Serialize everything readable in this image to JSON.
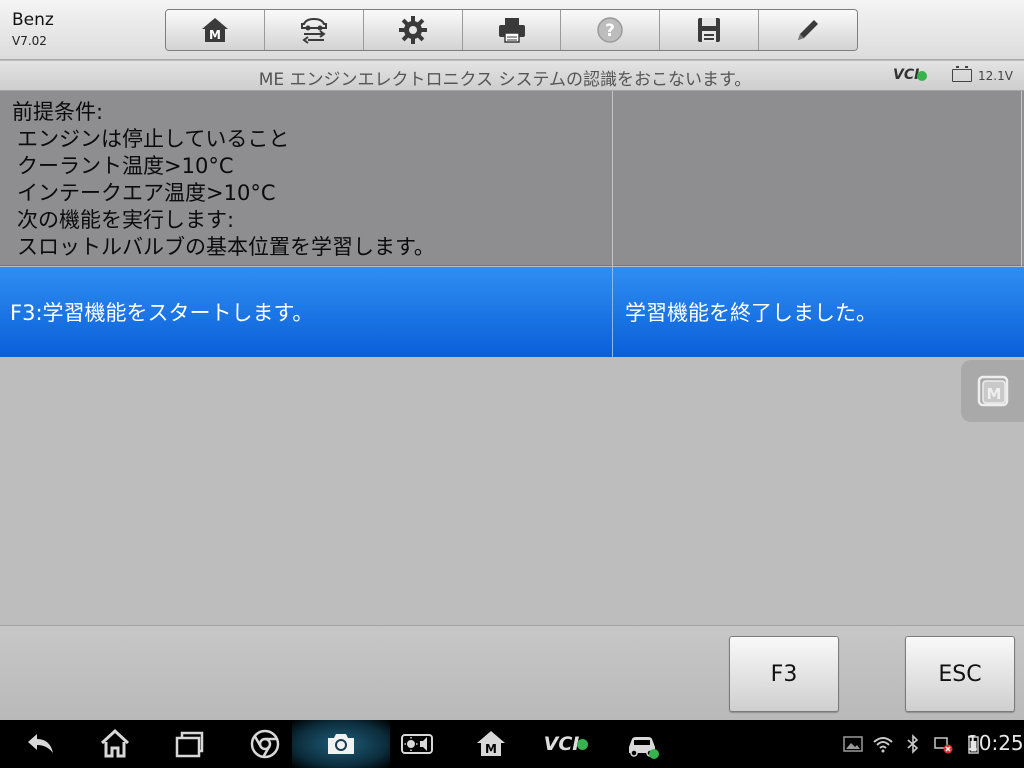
{
  "app": {
    "name": "Benz",
    "version": "V7.02"
  },
  "toolbar": {
    "buttons": [
      {
        "icon": "home-m-icon"
      },
      {
        "icon": "vehicle-swap-icon"
      },
      {
        "icon": "gear-icon"
      },
      {
        "icon": "printer-icon"
      },
      {
        "icon": "help-icon"
      },
      {
        "icon": "save-icon"
      },
      {
        "icon": "pencil-icon"
      }
    ]
  },
  "header": {
    "title": "ME エンジンエレクトロニクス システムの認識をおこないます。",
    "vci_label": "VCI",
    "voltage": "12.1V"
  },
  "table": {
    "info_lines": [
      "前提条件:",
      "エンジンは停止していること",
      "クーラント温度>10°C",
      "インテークエア温度>10°C",
      "次の機能を実行します:",
      "スロットルバルブの基本位置を学習します。"
    ],
    "selected_left": "F3:学習機能をスタートします。",
    "selected_right": "学習機能を終了しました。"
  },
  "bottom_buttons": {
    "f3": "F3",
    "esc": "ESC"
  },
  "system_bar": {
    "vci_label": "VCI",
    "time": "10:25"
  },
  "colors": {
    "selected_row": "#1a74e6",
    "info_row": "#8e8e90",
    "background": "#bdbdbd",
    "status_ok": "#37b24d"
  }
}
